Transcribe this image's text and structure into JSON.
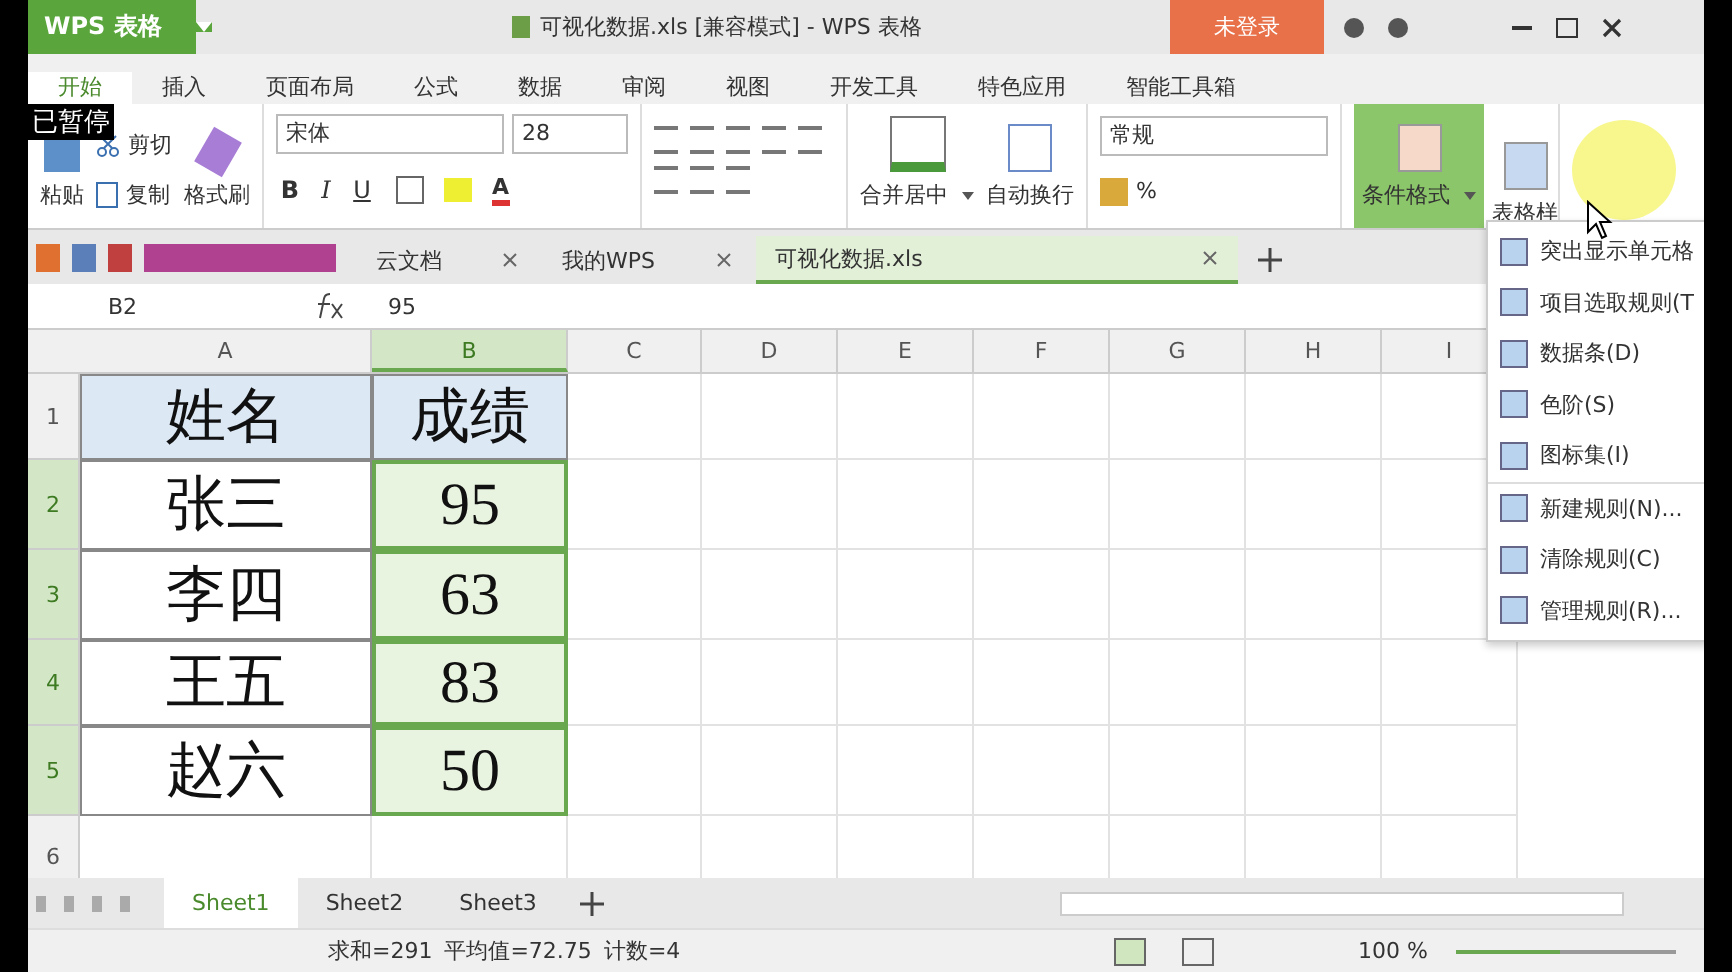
{
  "app_title": "WPS 表格",
  "doc_title": "可视化数据.xls [兼容模式] - WPS 表格",
  "login_button": "未登录",
  "overlay": "已暂停",
  "menu_tabs": [
    {
      "label": "开始",
      "selected": true
    },
    {
      "label": "插入",
      "selected": false
    },
    {
      "label": "页面布局",
      "selected": false
    },
    {
      "label": "公式",
      "selected": false
    },
    {
      "label": "数据",
      "selected": false
    },
    {
      "label": "审阅",
      "selected": false
    },
    {
      "label": "视图",
      "selected": false
    },
    {
      "label": "开发工具",
      "selected": false
    },
    {
      "label": "特色应用",
      "selected": false
    },
    {
      "label": "智能工具箱",
      "selected": false
    }
  ],
  "ribbon": {
    "paste": "粘贴",
    "cut": "剪切",
    "copy": "复制",
    "format_painter": "格式刷",
    "font_name": "宋体",
    "font_size": "28",
    "bold": "B",
    "italic": "I",
    "underline": "U",
    "font_color": "A",
    "merge": "合并居中",
    "wrap": "自动换行",
    "number_format": "常规",
    "percent": "%",
    "cond_format": "条件格式",
    "table_style": "表格样"
  },
  "doc_tabs": [
    {
      "label": "云文档",
      "selected": false
    },
    {
      "label": "我的WPS",
      "selected": false
    },
    {
      "label": "可视化数据.xls",
      "selected": true
    }
  ],
  "name_box": "B2",
  "formula": "95",
  "columns": [
    {
      "label": "A",
      "selected": false
    },
    {
      "label": "B",
      "selected": true
    },
    {
      "label": "C",
      "selected": false
    },
    {
      "label": "D",
      "selected": false
    },
    {
      "label": "E",
      "selected": false
    },
    {
      "label": "F",
      "selected": false
    },
    {
      "label": "G",
      "selected": false
    },
    {
      "label": "H",
      "selected": false
    },
    {
      "label": "I",
      "selected": false
    }
  ],
  "rows": [
    {
      "number": "1",
      "selected": false,
      "kind": "header",
      "cells": [
        {
          "text": "姓名",
          "selected": false
        },
        {
          "text": "成绩",
          "selected": false
        }
      ]
    },
    {
      "number": "2",
      "selected": true,
      "kind": "data",
      "cells": [
        {
          "text": "张三",
          "selected": false
        },
        {
          "text": "95",
          "selected": true
        }
      ]
    },
    {
      "number": "3",
      "selected": true,
      "kind": "data",
      "cells": [
        {
          "text": "李四",
          "selected": false
        },
        {
          "text": "63",
          "selected": true
        }
      ]
    },
    {
      "number": "4",
      "selected": true,
      "kind": "data",
      "cells": [
        {
          "text": "王五",
          "selected": false
        },
        {
          "text": "83",
          "selected": true
        }
      ]
    },
    {
      "number": "5",
      "selected": true,
      "kind": "data",
      "cells": [
        {
          "text": "赵六",
          "selected": false
        },
        {
          "text": "50",
          "selected": true
        }
      ]
    },
    {
      "number": "6",
      "selected": false,
      "kind": "empty",
      "cells": []
    }
  ],
  "dropdown": [
    [
      "突出显示单元格",
      "项目选取规则(T",
      "数据条(D)",
      "色阶(S)",
      "图标集(I)"
    ],
    [
      "新建规则(N)...",
      "清除规则(C)",
      "管理规则(R)..."
    ]
  ],
  "sheet_tabs": [
    {
      "label": "Sheet1",
      "selected": true
    },
    {
      "label": "Sheet2",
      "selected": false
    },
    {
      "label": "Sheet3",
      "selected": false
    }
  ],
  "status": [
    "求和=291",
    "平均值=72.75",
    "计数=4"
  ],
  "zoom": "100 %",
  "zoom_level": {
    "level": 0.47
  }
}
